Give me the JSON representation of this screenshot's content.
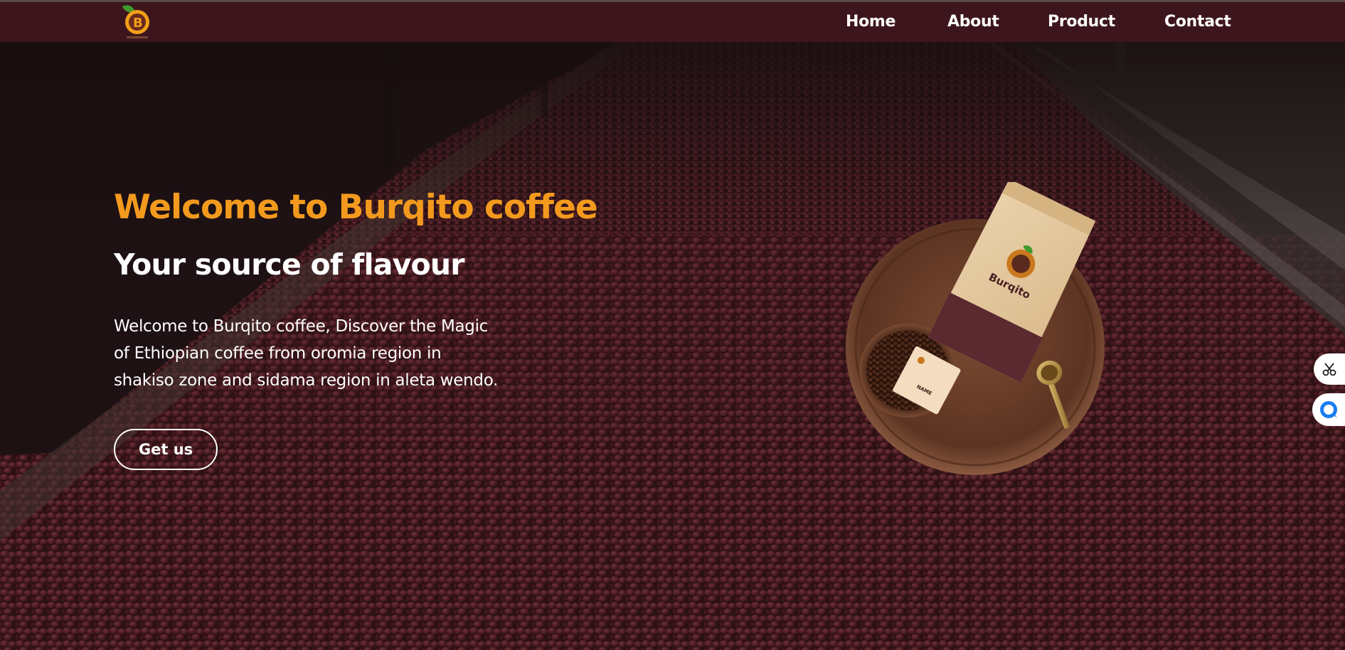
{
  "nav": {
    "logo_alt": "Burqito logo",
    "links": [
      {
        "label": "Home"
      },
      {
        "label": "About"
      },
      {
        "label": "Product"
      },
      {
        "label": "Contact"
      }
    ]
  },
  "hero": {
    "title": "Welcome to Burqito coffee",
    "subtitle": "Your source of flavour",
    "description_lines": [
      "Welcome to Burqito coffee, Discover the Magic",
      "of Ethiopian coffee from oromia region in",
      "shakiso zone and sidama region in aleta wendo."
    ],
    "cta_label": "Get us"
  },
  "product": {
    "bag_brand": "Burqito",
    "card_text": "NAME"
  },
  "side_tools": {
    "scissors_icon": "scissors-icon",
    "chat_icon": "chat-bubble-icon"
  },
  "colors": {
    "navbar": "#3d161d",
    "title_orange": "#f39a1e",
    "text": "#ffffff"
  }
}
